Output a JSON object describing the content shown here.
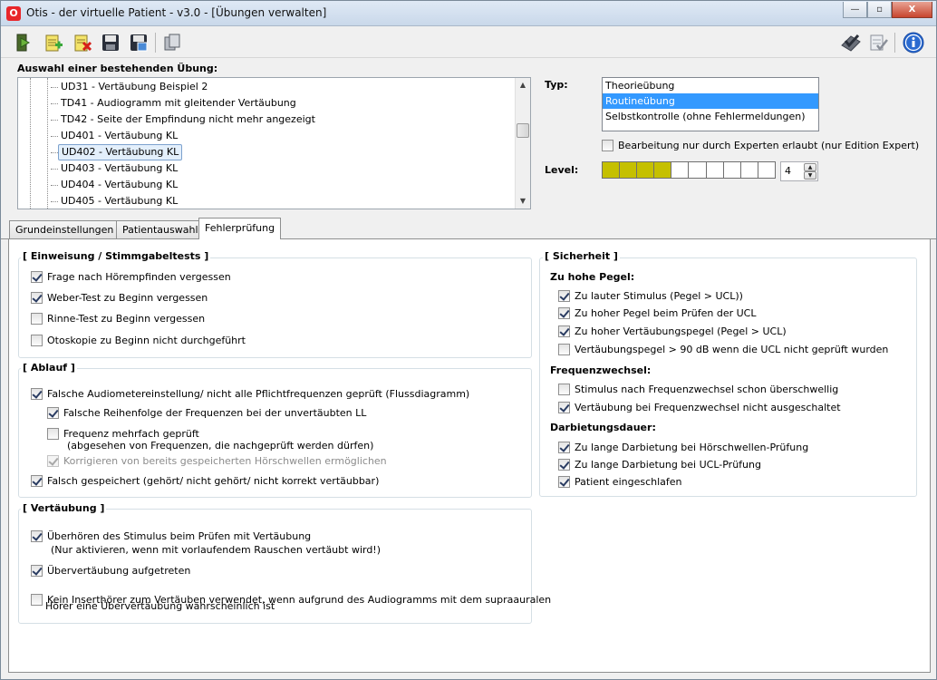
{
  "window": {
    "app_icon": "O",
    "title": "Otis - der virtuelle Patient - v3.0 - [Übungen verwalten]",
    "minimize_glyph": "—",
    "maximize_glyph": "▫",
    "close_glyph": "X"
  },
  "toolbar": {
    "icons": [
      "exit-door-icon",
      "new-document-icon",
      "delete-document-icon",
      "save-icon",
      "save-as-icon",
      "copy-icon",
      "approve-icon",
      "checklist-icon",
      "info-icon"
    ]
  },
  "exercise_select": {
    "label": "Auswahl einer bestehenden Übung:",
    "items": [
      "UD31 - Vertäubung Beispiel 2",
      "TD41 - Audiogramm mit gleitender Vertäubung",
      "TD42 - Seite der Empfindung nicht mehr angezeigt",
      "UD401 - Vertäubung KL",
      "UD402 - Vertäubung KL",
      "UD403 - Vertäubung KL",
      "UD404 - Vertäubung KL",
      "UD405 - Vertäubung KL"
    ],
    "selected_index": 4
  },
  "type": {
    "label": "Typ:",
    "options": [
      "Theorieübung",
      "Routineübung",
      "Selbstkontrolle (ohne Fehlermeldungen)"
    ],
    "selected_index": 1
  },
  "expert_only": {
    "label": "Bearbeitung nur durch Experten erlaubt (nur Edition Expert)",
    "checked": false
  },
  "level": {
    "label": "Level:",
    "value": "4",
    "max": 10
  },
  "tabs": [
    "Grundeinstellungen",
    "Patientauswahl",
    "Fehlerprüfung"
  ],
  "active_tab": 2,
  "groups": {
    "einweisung": {
      "title": "[ Einweisung / Stimmgabeltests ]",
      "items": [
        {
          "label": "Frage nach Hörempfinden vergessen",
          "checked": true
        },
        {
          "label": "Weber-Test zu Beginn vergessen",
          "checked": true
        },
        {
          "label": "Rinne-Test zu Beginn vergessen",
          "checked": false
        },
        {
          "label": "Otoskopie zu Beginn nicht durchgeführt",
          "checked": false
        }
      ]
    },
    "ablauf": {
      "title": "[ Ablauf ]",
      "items": [
        {
          "label": "Falsche Audiometereinstellung/ nicht alle Pflichtfrequenzen geprüft (Flussdiagramm)",
          "checked": true
        },
        {
          "label": "Falsche Reihenfolge der Frequenzen bei der unvertäubten LL",
          "checked": true
        },
        {
          "label": "Frequenz mehrfach geprüft",
          "checked": false
        },
        {
          "label": "Korrigieren von bereits gespeicherten Hörschwellen ermöglichen",
          "checked": true,
          "disabled": true
        },
        {
          "label": "Falsch gespeichert (gehört/ nicht gehört/ nicht korrekt vertäubbar)",
          "checked": true
        }
      ],
      "note": "(abgesehen von Frequenzen, die nachgeprüft werden dürfen)"
    },
    "vertaeubung": {
      "title": "[ Vertäubung ]",
      "items": [
        {
          "label": "Überhören des Stimulus beim Prüfen mit Vertäubung",
          "checked": true
        },
        {
          "label": "Übervertäubung aufgetreten",
          "checked": true
        },
        {
          "label": "Kein Inserthörer zum Vertäuben verwendet, wenn aufgrund des Audiogramms mit dem supraauralen",
          "checked": false
        }
      ],
      "note1": "(Nur aktivieren, wenn mit vorlaufendem Rauschen vertäubt wird!)",
      "note2": "Hörer eine Übervertäubung wahrscheinlich ist"
    },
    "sicherheit": {
      "title": "[ Sicherheit ]",
      "sub1": "Zu hohe Pegel:",
      "sub1_items": [
        {
          "label": "Zu lauter Stimulus (Pegel > UCL))",
          "checked": true
        },
        {
          "label": "Zu hoher Pegel beim Prüfen der UCL",
          "checked": true
        },
        {
          "label": "Zu hoher Vertäubungspegel  (Pegel > UCL)",
          "checked": true
        },
        {
          "label": "Vertäubungspegel > 90 dB wenn die UCL nicht geprüft wurden",
          "checked": false
        }
      ],
      "sub2": "Frequenzwechsel:",
      "sub2_items": [
        {
          "label": "Stimulus nach Frequenzwechsel schon überschwellig",
          "checked": false
        },
        {
          "label": "Vertäubung bei Frequenzwechsel nicht ausgeschaltet",
          "checked": true
        }
      ],
      "sub3": "Darbietungsdauer:",
      "sub3_items": [
        {
          "label": "Zu lange Darbietung bei Hörschwellen-Prüfung",
          "checked": true
        },
        {
          "label": "Zu lange Darbietung bei UCL-Prüfung",
          "checked": true
        },
        {
          "label": "Patient eingeschlafen",
          "checked": true
        }
      ]
    }
  },
  "colors": {
    "level_fill": "#c5c000",
    "selection": "#3399ff"
  }
}
